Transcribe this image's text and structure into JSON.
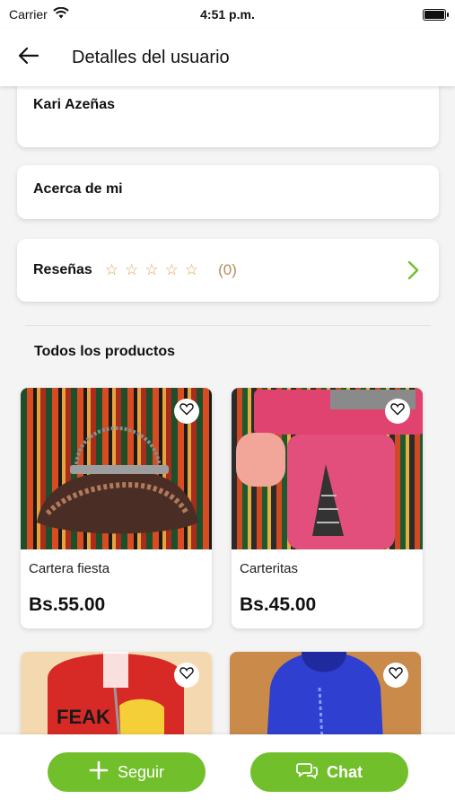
{
  "status_bar": {
    "carrier": "Carrier",
    "time": "4:51 p.m."
  },
  "nav": {
    "title": "Detalles del usuario"
  },
  "profile": {
    "name": "Kari Azeñas",
    "about_label": "Acerca de mi",
    "reviews_label": "Reseñas",
    "reviews_count": "(0)",
    "rating_stars": 0
  },
  "products_section": {
    "title": "Todos los productos"
  },
  "products": [
    {
      "name": "Cartera fiesta",
      "price": "Bs.55.00"
    },
    {
      "name": "Carteritas",
      "price": "Bs.45.00"
    }
  ],
  "actions": {
    "follow_label": "Seguir",
    "chat_label": "Chat"
  },
  "colors": {
    "accent": "#72bf2c",
    "star": "#d9a24a"
  }
}
